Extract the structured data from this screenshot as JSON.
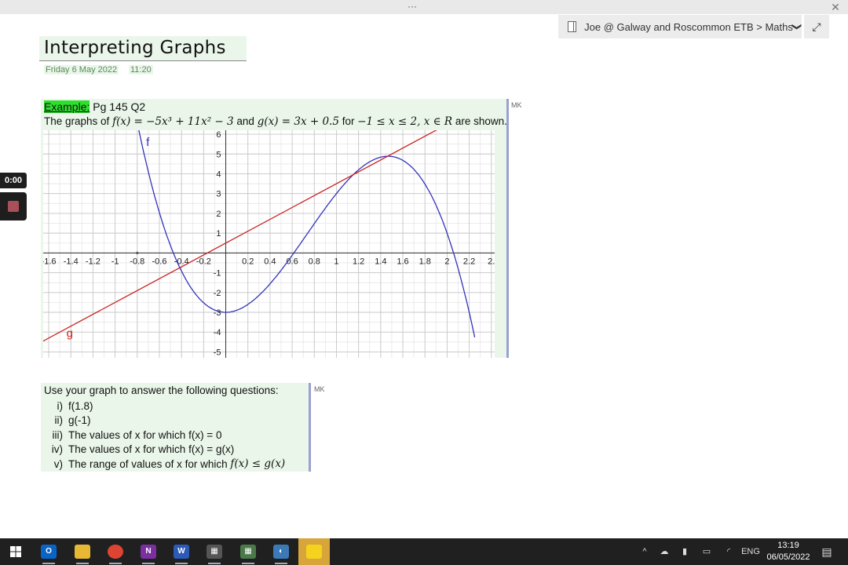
{
  "window": {
    "more_glyph": "···",
    "close_glyph": "✕"
  },
  "notebook": {
    "breadcrumb": "Joe @ Galway and Roscommon ETB > Maths",
    "chevron": "❯",
    "expand_glyph": "⤢"
  },
  "page": {
    "title": "Interpreting Graphs",
    "date": "Friday 6 May 2022",
    "time": "11:20"
  },
  "example": {
    "label": "Example:",
    "reference": "Pg 145 Q2",
    "desc_prefix": "The graphs of",
    "f_def": "f(x) = −5x³ + 11x² − 3",
    "and_text": "and",
    "g_def": "g(x) = 3x + 0.5",
    "for_text": "for",
    "domain_def": "−1 ≤ x ≤ 2, x ∈ R",
    "suffix": "are shown.",
    "author_tag": "MK"
  },
  "chart_data": {
    "type": "line",
    "x_ticks": [
      "-1.6",
      "-1.4",
      "-1.2",
      "-1",
      "-0.8",
      "-0.6",
      "-0.4",
      "-0.2",
      "0.2",
      "0.4",
      "0.6",
      "0.8",
      "1",
      "1.2",
      "1.4",
      "1.6",
      "1.8",
      "2",
      "2.2",
      "2."
    ],
    "y_ticks": [
      "6",
      "5",
      "4",
      "3",
      "2",
      "1",
      "-1",
      "-2",
      "-3",
      "-4",
      "-5"
    ],
    "xlim": [
      -1.65,
      2.43
    ],
    "ylim": [
      -5.3,
      6.2
    ],
    "grid": true,
    "series": [
      {
        "name": "f",
        "color": "#3333bb",
        "x": [
          -0.8,
          -0.7,
          -0.6,
          -0.5,
          -0.4,
          -0.3,
          -0.2,
          -0.1,
          0,
          0.2,
          0.4,
          0.6,
          0.8,
          1.0,
          1.2,
          1.4,
          1.467,
          1.6,
          1.8,
          2.0,
          2.1,
          2.2
        ],
        "y": [
          6.6,
          4.1,
          2.04,
          0.38,
          -0.92,
          -1.87,
          -2.52,
          -2.89,
          -3.0,
          -2.6,
          -1.56,
          -0.12,
          1.48,
          3.0,
          4.2,
          4.84,
          4.89,
          4.68,
          3.48,
          1.0,
          -0.79,
          -3.02
        ]
      },
      {
        "name": "g",
        "color": "#cc2222",
        "x": [
          -1.65,
          1.97
        ],
        "y": [
          -4.45,
          6.41
        ]
      }
    ]
  },
  "questions": {
    "intro": "Use your graph to answer the following questions:",
    "items": [
      {
        "num": "i)",
        "text": "f(1.8)"
      },
      {
        "num": "ii)",
        "text": "g(-1)"
      },
      {
        "num": "iii)",
        "text": "The values of x for which f(x) = 0"
      },
      {
        "num": "iv)",
        "text": "The values of x for which f(x) = g(x)"
      },
      {
        "num": "v)",
        "text": "The range of values of x for which",
        "math": "f(x) ≤ g(x)"
      }
    ],
    "author_tag": "MK"
  },
  "recording": {
    "time": "0:00"
  },
  "taskbar": {
    "apps": [
      {
        "name": "outlook-app",
        "letter": "O",
        "color": "#0a64c8"
      },
      {
        "name": "file-explorer-app",
        "letter": "",
        "color": "#e8b834"
      },
      {
        "name": "chrome-app",
        "letter": "",
        "color": "#dd4433"
      },
      {
        "name": "onenote-app",
        "letter": "N",
        "color": "#7b2fa0"
      },
      {
        "name": "word-app",
        "letter": "W",
        "color": "#2b5ab8"
      },
      {
        "name": "calculator-app",
        "letter": "▦",
        "color": "#555555"
      },
      {
        "name": "calculator2-app",
        "letter": "▦",
        "color": "#4a7a4a"
      },
      {
        "name": "media-app",
        "letter": "◐",
        "color": "#3a7ab8"
      },
      {
        "name": "sticky-notes-app",
        "letter": "",
        "color": "#f5d21e"
      }
    ],
    "tray": {
      "lang": "ENG",
      "time": "13:19",
      "date": "06/05/2022"
    }
  }
}
